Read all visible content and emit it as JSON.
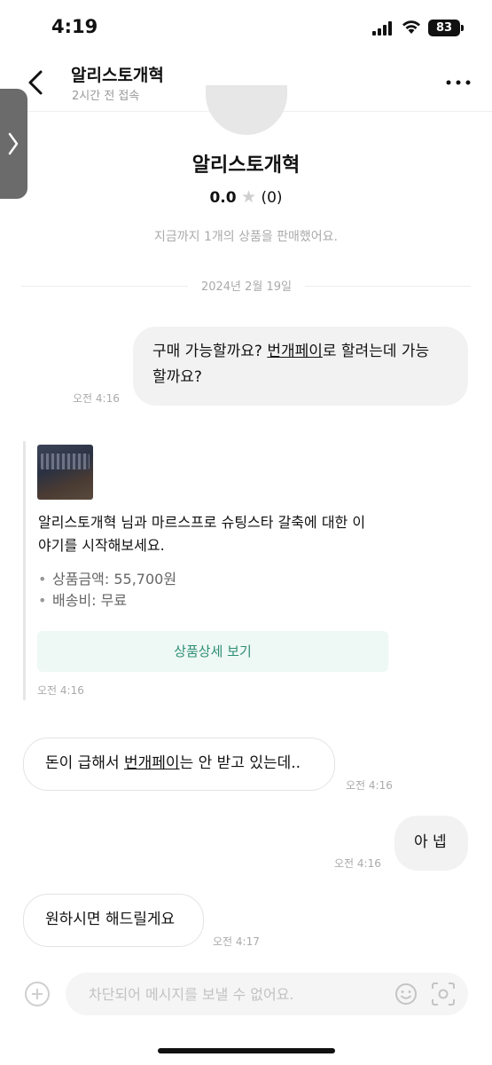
{
  "status_bar": {
    "time": "4:19",
    "battery": "83"
  },
  "header": {
    "title": "알리스토개혁",
    "subtitle": "2시간 전 접속",
    "back_icon": "chevron-left-icon",
    "more_icon": "more-dots-icon"
  },
  "profile": {
    "name": "알리스토개혁",
    "rating": "0.0",
    "rating_count": "(0)",
    "sold_text": "지금까지 1개의 상품을 판매했어요."
  },
  "date_divider": "2024년 2월 19일",
  "messages": [
    {
      "sender": "me",
      "parts": [
        "구매 가능할까요? ",
        "번개페이",
        "로 할려는데 가능",
        "할까요?"
      ],
      "time": "오전 4:16"
    },
    {
      "sender": "system-card",
      "text_line1": "알리스토개혁 님과 마르스프로 슈팅스타 갈축에 대한 이",
      "text_line2": "야기를 시작해보세요.",
      "price": "상품금액: 55,700원",
      "shipping": "배송비: 무료",
      "button": "상품상세 보기",
      "time": "오전 4:16"
    },
    {
      "sender": "other",
      "parts": [
        "돈이 급해서 ",
        "번개페이",
        "는 안 받고 있는데.."
      ],
      "time": "오전 4:16"
    },
    {
      "sender": "me",
      "text": "아 넵",
      "time": "오전 4:16"
    },
    {
      "sender": "other",
      "text": "원하시면 해드릴게요",
      "time": "오전 4:17"
    }
  ],
  "input": {
    "placeholder": "차단되어 메시지를 보낼 수 없어요."
  },
  "colors": {
    "accent_green": "#2f8f74",
    "card_button_bg": "#eef8f5",
    "my_bubble_bg": "#f2f2f2"
  }
}
